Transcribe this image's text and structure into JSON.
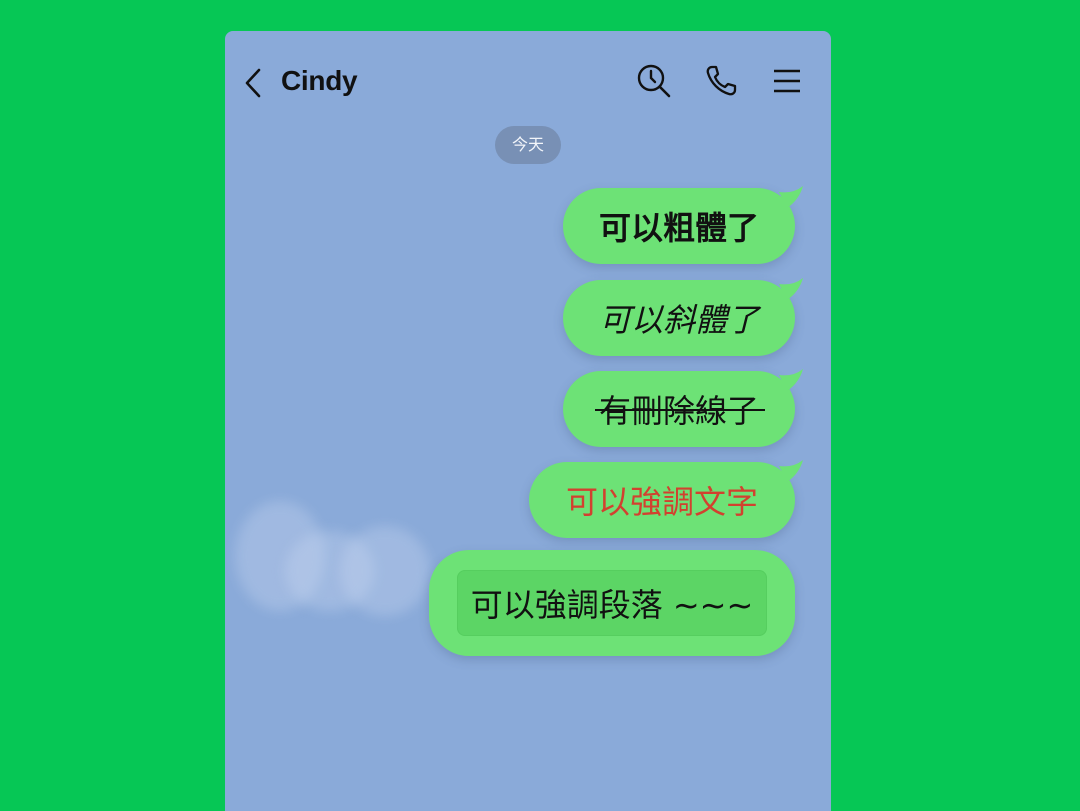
{
  "header": {
    "title": "Cindy",
    "icons": [
      "back-chevron-icon",
      "search-history-icon",
      "phone-icon",
      "menu-icon"
    ]
  },
  "date_divider": "今天",
  "messages": [
    {
      "text": "可以粗體了",
      "style": "bold",
      "sender": "me"
    },
    {
      "text": "可以斜體了",
      "style": "italic",
      "sender": "me"
    },
    {
      "text": "有刪除線了",
      "style": "strikethrough",
      "sender": "me"
    },
    {
      "text": "可以強調文字",
      "style": "highlight-red",
      "sender": "me",
      "color": "#d2412f"
    },
    {
      "text": "可以強調段落 ~~~",
      "style": "paragraph-block",
      "sender": "me"
    }
  ],
  "colors": {
    "page_background": "#06c755",
    "chat_background": "#8aaad9",
    "bubble": "#6de276",
    "date_pill": "#7890b5",
    "emphasis_text": "#d2412f"
  }
}
